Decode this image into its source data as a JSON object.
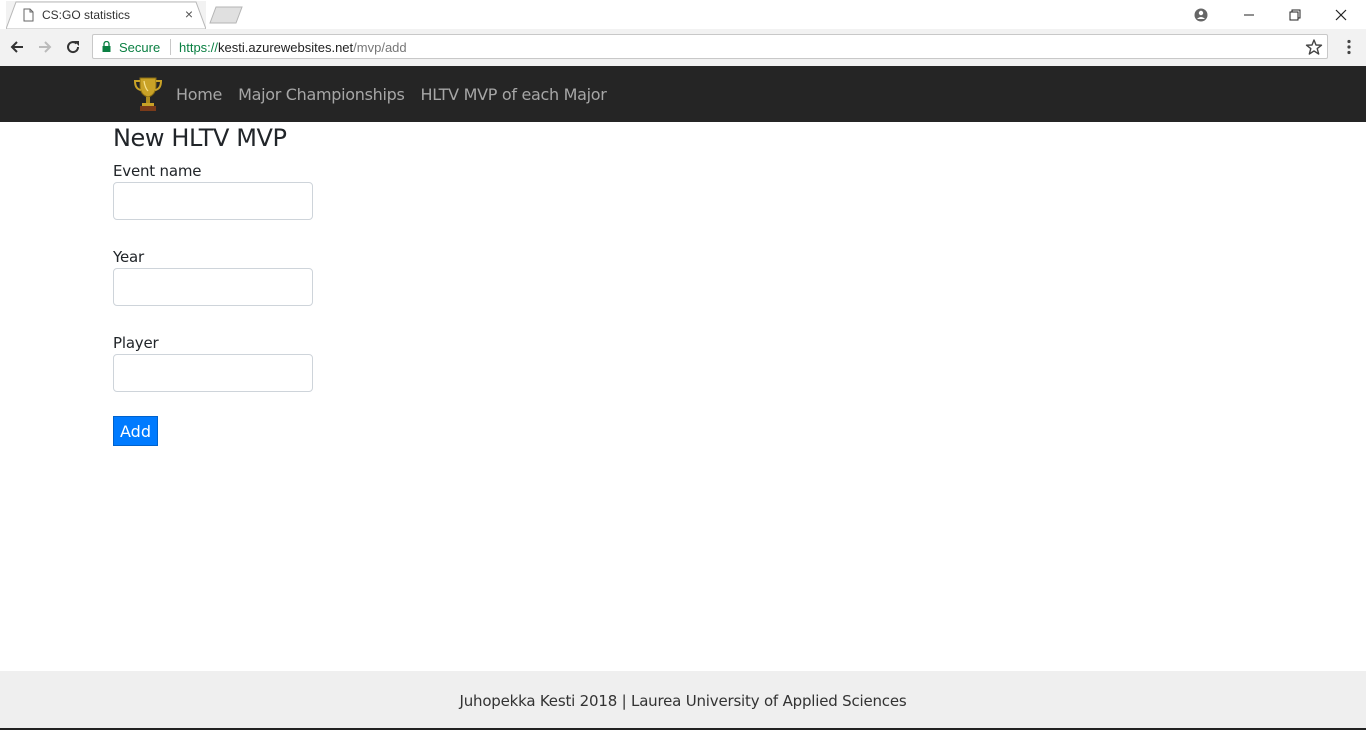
{
  "browser": {
    "tab_title": "CS:GO statistics",
    "close_tab_glyph": "×",
    "address": {
      "secure_label": "Secure",
      "scheme": "https://",
      "host": "kesti.azurewebsites.net",
      "path": "/mvp/add"
    },
    "icons": [
      "page-icon",
      "new-tab",
      "profile-icon",
      "minimize-icon",
      "restore-icon",
      "close-icon",
      "back-icon",
      "forward-icon",
      "reload-icon",
      "lock-icon",
      "star-icon",
      "menu-icon"
    ]
  },
  "navbar": {
    "brand_icon": "trophy-icon",
    "links": [
      {
        "label": "Home"
      },
      {
        "label": "Major Championships"
      },
      {
        "label": "HLTV MVP of each Major"
      }
    ]
  },
  "form": {
    "title": "New HLTV MVP",
    "fields": [
      {
        "label": "Event name",
        "value": ""
      },
      {
        "label": "Year",
        "value": ""
      },
      {
        "label": "Player",
        "value": ""
      }
    ],
    "submit_label": "Add"
  },
  "footer": {
    "text": "Juhopekka Kesti 2018 | Laurea University of Applied Sciences"
  },
  "colors": {
    "navbar_bg": "#252525",
    "nav_link": "#a6a6a6",
    "button_primary": "#007bff",
    "footer_bg": "#efefef",
    "secure_green": "#0b8043"
  }
}
